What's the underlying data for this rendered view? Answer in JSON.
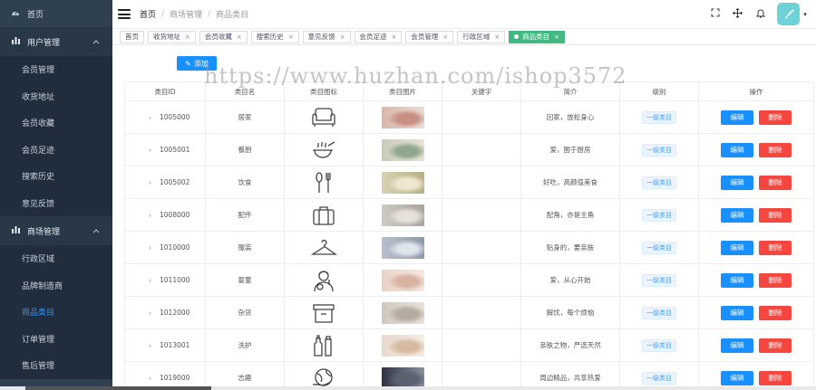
{
  "sidebar": {
    "home": {
      "label": "首页",
      "icon": "dashboard-icon"
    },
    "user_group": {
      "label": "用户管理",
      "icon": "bar-chart-icon",
      "items": [
        "会员管理",
        "收货地址",
        "会员收藏",
        "会员足迹",
        "搜索历史",
        "意见反馈"
      ]
    },
    "mall_group": {
      "label": "商场管理",
      "icon": "bar-chart-icon",
      "items": [
        "行政区域",
        "品牌制造商",
        "商品类目",
        "订单管理",
        "售后管理"
      ],
      "active_index": 2
    }
  },
  "header": {
    "breadcrumbs": [
      "首页",
      "商场管理",
      "商品类目"
    ],
    "icons": [
      "fullscreen-icon",
      "move-icon",
      "bell-icon"
    ],
    "avatar_icon": "brush-icon"
  },
  "tags": [
    {
      "label": "首页",
      "closable": false
    },
    {
      "label": "收货地址",
      "closable": true
    },
    {
      "label": "会员收藏",
      "closable": true
    },
    {
      "label": "搜索历史",
      "closable": true
    },
    {
      "label": "意见反馈",
      "closable": true
    },
    {
      "label": "会员足迹",
      "closable": true
    },
    {
      "label": "会员管理",
      "closable": true
    },
    {
      "label": "行政区域",
      "closable": true
    },
    {
      "label": "商品类目",
      "closable": true,
      "active": true
    }
  ],
  "toolbar": {
    "add_label": "添加"
  },
  "table": {
    "headers": [
      "类目ID",
      "类目名",
      "类目图标",
      "类目图片",
      "关键字",
      "简介",
      "级别",
      "操作"
    ],
    "edit_label": "编辑",
    "delete_label": "删除",
    "rows": [
      {
        "id": "1005000",
        "name": "居家",
        "icon": "sofa-icon",
        "keyword": "",
        "desc": "回家，放松身心",
        "level": "一级类目",
        "photo": [
          "#d9b7a8",
          "#c98f84",
          "#e8ddd6"
        ]
      },
      {
        "id": "1005001",
        "name": "餐厨",
        "icon": "cooking-pot-icon",
        "keyword": "",
        "desc": "爱，囿于厨房",
        "level": "一级类目",
        "photo": [
          "#c9cbb8",
          "#8fa88c",
          "#e8e3d4"
        ]
      },
      {
        "id": "1005002",
        "name": "饮食",
        "icon": "spoon-fork-icon",
        "keyword": "",
        "desc": "好吃，高颜值美食",
        "level": "一级类目",
        "photo": [
          "#d8d2b4",
          "#eee8cf",
          "#b8ad84"
        ]
      },
      {
        "id": "1008000",
        "name": "配件",
        "icon": "suitcase-icon",
        "keyword": "",
        "desc": "配角，亦是主角",
        "level": "一级类目",
        "photo": [
          "#cfcac3",
          "#e5e1da",
          "#a9a39b"
        ]
      },
      {
        "id": "1010000",
        "name": "服装",
        "icon": "hanger-icon",
        "keyword": "",
        "desc": "贴身的，要亲肤",
        "level": "一级类目",
        "photo": [
          "#b9c0cc",
          "#dfe3ea",
          "#8f98a8"
        ]
      },
      {
        "id": "1011000",
        "name": "婴童",
        "icon": "mother-child-icon",
        "keyword": "",
        "desc": "爱，从心开始",
        "level": "一级类目",
        "photo": [
          "#e9d2c6",
          "#d8b3a2",
          "#f4e9e2"
        ]
      },
      {
        "id": "1012000",
        "name": "杂货",
        "icon": "storage-box-icon",
        "keyword": "",
        "desc": "解忧，每个烦恼",
        "level": "一级类目",
        "photo": [
          "#cfc8bf",
          "#b5ab9e",
          "#e6e1da"
        ]
      },
      {
        "id": "1013001",
        "name": "洗护",
        "icon": "bottles-icon",
        "keyword": "",
        "desc": "亲肤之物，严选天然",
        "level": "一级类目",
        "photo": [
          "#e7d9cc",
          "#d6b99f",
          "#f2ebe4"
        ]
      },
      {
        "id": "1019000",
        "name": "志趣",
        "icon": "globe-hand-icon",
        "keyword": "",
        "desc": "周边精品，共享热爱",
        "level": "一级类目",
        "photo": [
          "#2f3340",
          "#5c6170",
          "#8b90a0"
        ]
      }
    ]
  },
  "watermark": "https://www.huzhan.com/ishop3572",
  "colors": {
    "sidebar_bg": "#2f4050",
    "primary": "#1890ff",
    "danger": "#f5463f",
    "active_tag": "#42b983",
    "active_link": "#3b8ef0"
  }
}
